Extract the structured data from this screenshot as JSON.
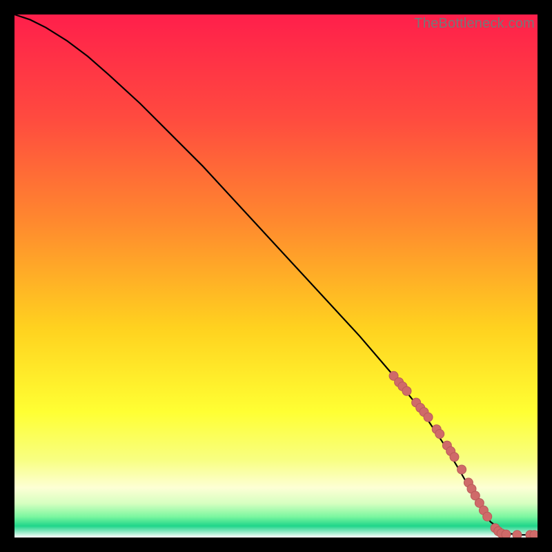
{
  "watermark": "TheBottleneck.com",
  "colors": {
    "frame": "#000000",
    "curve": "#000000",
    "dot_fill": "#cf6a69",
    "dot_stroke": "#b95a59",
    "gradient_stops": [
      {
        "offset": 0.0,
        "color": "#ff1f4b"
      },
      {
        "offset": 0.2,
        "color": "#ff4b3f"
      },
      {
        "offset": 0.4,
        "color": "#ff8a2e"
      },
      {
        "offset": 0.6,
        "color": "#ffd21f"
      },
      {
        "offset": 0.76,
        "color": "#ffff33"
      },
      {
        "offset": 0.85,
        "color": "#f8ff80"
      },
      {
        "offset": 0.905,
        "color": "#fdffd5"
      },
      {
        "offset": 0.935,
        "color": "#d6ffc0"
      },
      {
        "offset": 0.96,
        "color": "#7cf7a0"
      },
      {
        "offset": 0.978,
        "color": "#1fd58a"
      },
      {
        "offset": 1.0,
        "color": "#ffffff"
      }
    ]
  },
  "chart_data": {
    "type": "line",
    "title": "",
    "xlabel": "",
    "ylabel": "",
    "xlim": [
      0,
      100
    ],
    "ylim": [
      0,
      100
    ],
    "series": [
      {
        "name": "curve",
        "x": [
          0,
          3,
          6,
          10,
          14,
          18,
          24,
          30,
          36,
          42,
          48,
          54,
          60,
          66,
          72,
          78,
          82,
          85,
          87,
          89,
          91,
          94,
          97,
          100
        ],
        "y": [
          100,
          99,
          97.5,
          95,
          92,
          88.5,
          83,
          77,
          71,
          64.5,
          58,
          51.5,
          45,
          38.5,
          31.5,
          24,
          18,
          13,
          9.5,
          6,
          3,
          0.8,
          0.5,
          0.5
        ]
      }
    ],
    "highlight_dots": {
      "name": "dots",
      "x": [
        72.5,
        73.5,
        74.2,
        75.0,
        76.8,
        77.6,
        78.3,
        79.1,
        80.7,
        81.3,
        82.7,
        83.4,
        84.1,
        85.5,
        86.8,
        87.4,
        88.1,
        88.9,
        89.7,
        90.4,
        91.9,
        92.5,
        93.1,
        94.0,
        96.1,
        98.6,
        99.4
      ],
      "y": [
        30.9,
        29.7,
        28.9,
        28.0,
        25.8,
        24.8,
        24.0,
        23.0,
        20.7,
        19.8,
        17.6,
        16.5,
        15.4,
        13.0,
        10.5,
        9.3,
        8.0,
        6.6,
        5.2,
        4.0,
        1.8,
        1.2,
        0.8,
        0.6,
        0.5,
        0.5,
        0.5
      ]
    }
  }
}
